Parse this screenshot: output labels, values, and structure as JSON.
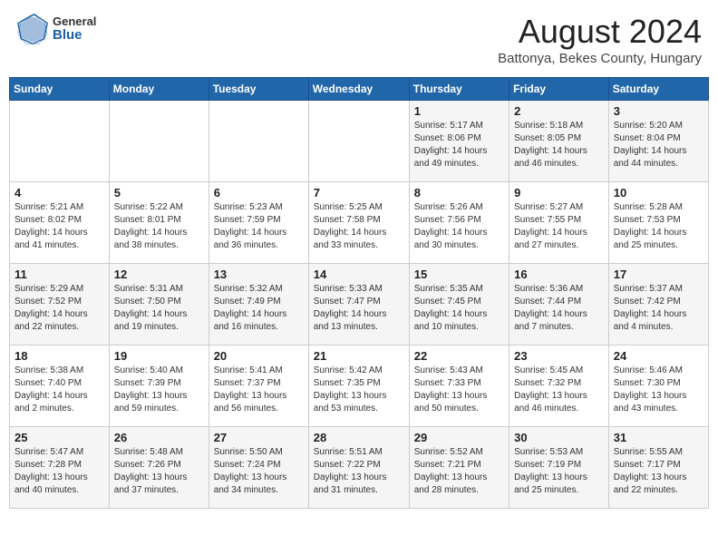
{
  "header": {
    "logo_general": "General",
    "logo_blue": "Blue",
    "month_title": "August 2024",
    "location": "Battonya, Bekes County, Hungary"
  },
  "weekdays": [
    "Sunday",
    "Monday",
    "Tuesday",
    "Wednesday",
    "Thursday",
    "Friday",
    "Saturday"
  ],
  "weeks": [
    [
      {
        "day": "",
        "info": ""
      },
      {
        "day": "",
        "info": ""
      },
      {
        "day": "",
        "info": ""
      },
      {
        "day": "",
        "info": ""
      },
      {
        "day": "1",
        "info": "Sunrise: 5:17 AM\nSunset: 8:06 PM\nDaylight: 14 hours\nand 49 minutes."
      },
      {
        "day": "2",
        "info": "Sunrise: 5:18 AM\nSunset: 8:05 PM\nDaylight: 14 hours\nand 46 minutes."
      },
      {
        "day": "3",
        "info": "Sunrise: 5:20 AM\nSunset: 8:04 PM\nDaylight: 14 hours\nand 44 minutes."
      }
    ],
    [
      {
        "day": "4",
        "info": "Sunrise: 5:21 AM\nSunset: 8:02 PM\nDaylight: 14 hours\nand 41 minutes."
      },
      {
        "day": "5",
        "info": "Sunrise: 5:22 AM\nSunset: 8:01 PM\nDaylight: 14 hours\nand 38 minutes."
      },
      {
        "day": "6",
        "info": "Sunrise: 5:23 AM\nSunset: 7:59 PM\nDaylight: 14 hours\nand 36 minutes."
      },
      {
        "day": "7",
        "info": "Sunrise: 5:25 AM\nSunset: 7:58 PM\nDaylight: 14 hours\nand 33 minutes."
      },
      {
        "day": "8",
        "info": "Sunrise: 5:26 AM\nSunset: 7:56 PM\nDaylight: 14 hours\nand 30 minutes."
      },
      {
        "day": "9",
        "info": "Sunrise: 5:27 AM\nSunset: 7:55 PM\nDaylight: 14 hours\nand 27 minutes."
      },
      {
        "day": "10",
        "info": "Sunrise: 5:28 AM\nSunset: 7:53 PM\nDaylight: 14 hours\nand 25 minutes."
      }
    ],
    [
      {
        "day": "11",
        "info": "Sunrise: 5:29 AM\nSunset: 7:52 PM\nDaylight: 14 hours\nand 22 minutes."
      },
      {
        "day": "12",
        "info": "Sunrise: 5:31 AM\nSunset: 7:50 PM\nDaylight: 14 hours\nand 19 minutes."
      },
      {
        "day": "13",
        "info": "Sunrise: 5:32 AM\nSunset: 7:49 PM\nDaylight: 14 hours\nand 16 minutes."
      },
      {
        "day": "14",
        "info": "Sunrise: 5:33 AM\nSunset: 7:47 PM\nDaylight: 14 hours\nand 13 minutes."
      },
      {
        "day": "15",
        "info": "Sunrise: 5:35 AM\nSunset: 7:45 PM\nDaylight: 14 hours\nand 10 minutes."
      },
      {
        "day": "16",
        "info": "Sunrise: 5:36 AM\nSunset: 7:44 PM\nDaylight: 14 hours\nand 7 minutes."
      },
      {
        "day": "17",
        "info": "Sunrise: 5:37 AM\nSunset: 7:42 PM\nDaylight: 14 hours\nand 4 minutes."
      }
    ],
    [
      {
        "day": "18",
        "info": "Sunrise: 5:38 AM\nSunset: 7:40 PM\nDaylight: 14 hours\nand 2 minutes."
      },
      {
        "day": "19",
        "info": "Sunrise: 5:40 AM\nSunset: 7:39 PM\nDaylight: 13 hours\nand 59 minutes."
      },
      {
        "day": "20",
        "info": "Sunrise: 5:41 AM\nSunset: 7:37 PM\nDaylight: 13 hours\nand 56 minutes."
      },
      {
        "day": "21",
        "info": "Sunrise: 5:42 AM\nSunset: 7:35 PM\nDaylight: 13 hours\nand 53 minutes."
      },
      {
        "day": "22",
        "info": "Sunrise: 5:43 AM\nSunset: 7:33 PM\nDaylight: 13 hours\nand 50 minutes."
      },
      {
        "day": "23",
        "info": "Sunrise: 5:45 AM\nSunset: 7:32 PM\nDaylight: 13 hours\nand 46 minutes."
      },
      {
        "day": "24",
        "info": "Sunrise: 5:46 AM\nSunset: 7:30 PM\nDaylight: 13 hours\nand 43 minutes."
      }
    ],
    [
      {
        "day": "25",
        "info": "Sunrise: 5:47 AM\nSunset: 7:28 PM\nDaylight: 13 hours\nand 40 minutes."
      },
      {
        "day": "26",
        "info": "Sunrise: 5:48 AM\nSunset: 7:26 PM\nDaylight: 13 hours\nand 37 minutes."
      },
      {
        "day": "27",
        "info": "Sunrise: 5:50 AM\nSunset: 7:24 PM\nDaylight: 13 hours\nand 34 minutes."
      },
      {
        "day": "28",
        "info": "Sunrise: 5:51 AM\nSunset: 7:22 PM\nDaylight: 13 hours\nand 31 minutes."
      },
      {
        "day": "29",
        "info": "Sunrise: 5:52 AM\nSunset: 7:21 PM\nDaylight: 13 hours\nand 28 minutes."
      },
      {
        "day": "30",
        "info": "Sunrise: 5:53 AM\nSunset: 7:19 PM\nDaylight: 13 hours\nand 25 minutes."
      },
      {
        "day": "31",
        "info": "Sunrise: 5:55 AM\nSunset: 7:17 PM\nDaylight: 13 hours\nand 22 minutes."
      }
    ]
  ]
}
